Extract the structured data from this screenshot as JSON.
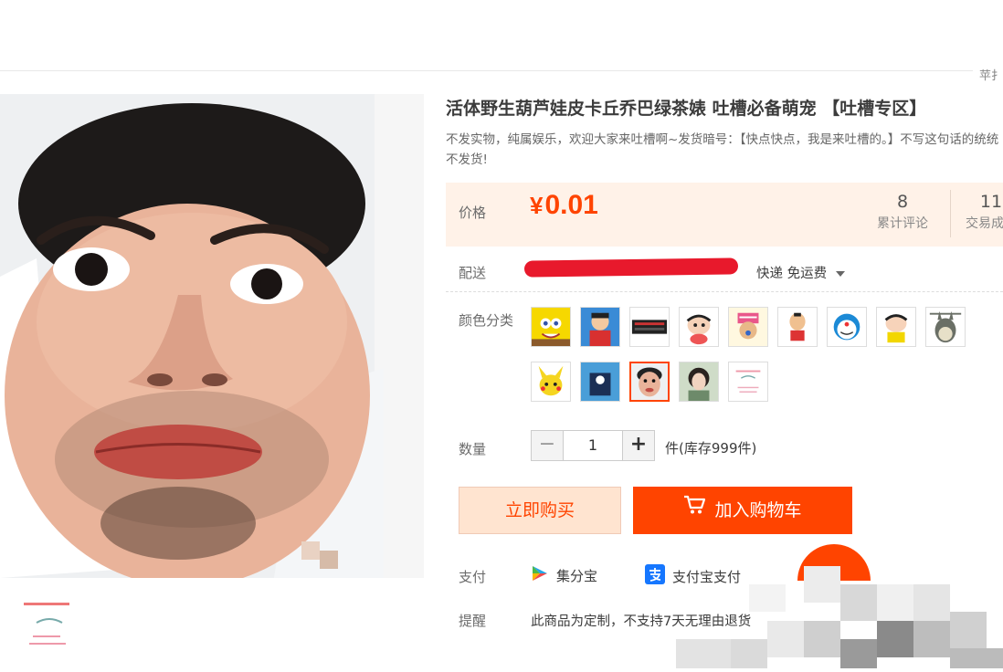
{
  "header": {
    "corner_text": "苹扌"
  },
  "product": {
    "title": "活体野生葫芦娃皮卡丘乔巴绿茶婊 吐槽必备萌宠 【吐槽专区】",
    "subtitle": "不发实物，纯属娱乐，欢迎大家来吐槽啊~发货暗号：【快点快点，我是来吐槽的。】不写这句话的统统不发货!",
    "price_label": "价格",
    "currency": "¥",
    "price": "0.01",
    "stats": [
      {
        "value": "8",
        "label": "累计评论"
      },
      {
        "value": "11",
        "label": "交易成功"
      }
    ],
    "shipping_label": "配送",
    "shipping_method": "快递 免运费",
    "color_label": "颜色分类",
    "swatches": [
      "spongebob",
      "cartoon-boy",
      "keyboard",
      "crayon-shin-chan",
      "chopper",
      "cartoon-character",
      "doraemon",
      "shin-chan",
      "totoro",
      "pikachu",
      "blue-cartoon",
      "face-photo",
      "girl-photo",
      "text-card"
    ],
    "selected_swatch_index": 11,
    "quantity_label": "数量",
    "quantity": "1",
    "quantity_minus": "−",
    "quantity_plus": "+",
    "stock_text": "件(库存999件)",
    "buy_now": "立即购买",
    "add_to_cart": "加入购物车",
    "payment_label": "支付",
    "payment_methods": [
      "集分宝",
      "支付宝支付"
    ],
    "remind_label": "提醒",
    "remind_text": "此商品为定制，不支持7天无理由退货"
  },
  "colors": {
    "accent": "#ff4400",
    "price_bg": "#fff2e8",
    "buy_bg": "#ffe4d0",
    "redaction": "#e8192c"
  }
}
